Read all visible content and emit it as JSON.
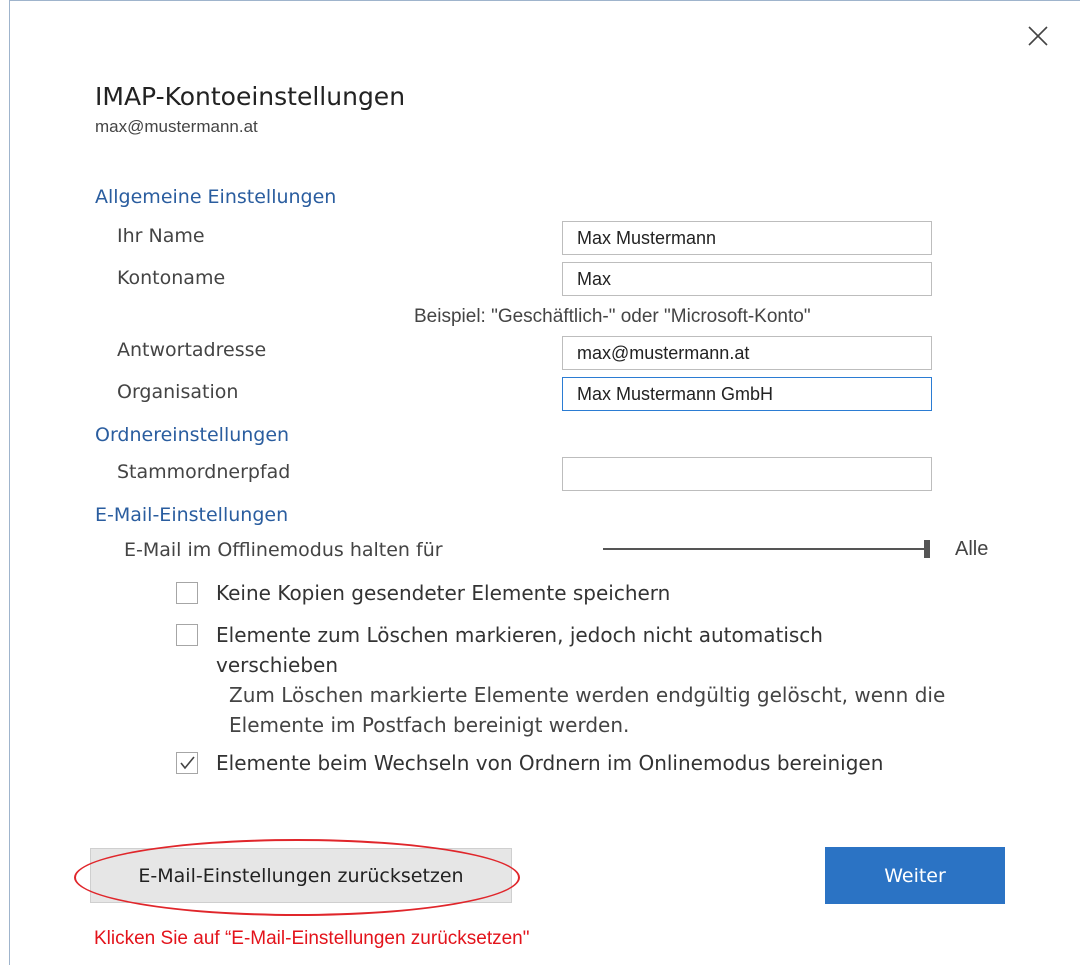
{
  "dialog": {
    "title": "IMAP-Kontoeinstellungen",
    "account_email": "max@mustermann.at"
  },
  "general": {
    "heading": "Allgemeine Einstellungen",
    "name_label": "Ihr Name",
    "name_value": "Max Mustermann",
    "account_name_label": "Kontoname",
    "account_name_value": "Max",
    "example_hint": "Beispiel: \"Geschäftlich-\" oder \"Microsoft-Konto\"",
    "reply_label": "Antwortadresse",
    "reply_value": "max@mustermann.at",
    "org_label": "Organisation",
    "org_value": "Max Mustermann GmbH"
  },
  "folders": {
    "heading": "Ordnereinstellungen",
    "root_label": "Stammordnerpfad",
    "root_value": ""
  },
  "mail": {
    "heading": "E-Mail-Einstellungen",
    "offline_label": "E-Mail im Offlinemodus halten für",
    "offline_value": "Alle",
    "offline_level": 1.0,
    "cb1_label": "Keine Kopien gesendeter Elemente speichern",
    "cb1_checked": false,
    "cb2_label": "Elemente zum Löschen markieren, jedoch nicht automatisch verschieben",
    "cb2_checked": false,
    "cb2_note": "Zum Löschen markierte Elemente werden endgültig gelöscht, wenn die Elemente im Postfach bereinigt werden.",
    "cb3_label": "Elemente beim Wechseln von Ordnern im Onlinemodus bereinigen",
    "cb3_checked": true
  },
  "buttons": {
    "reset_label": "E-Mail-Einstellungen zurücksetzen",
    "next_label": "Weiter"
  },
  "annotation": {
    "text": "Klicken Sie auf “E-Mail-Einstellungen zurücksetzen\"",
    "color": "#e3131b"
  },
  "icons": {
    "close": "close-icon",
    "check": "checkmark-icon"
  }
}
